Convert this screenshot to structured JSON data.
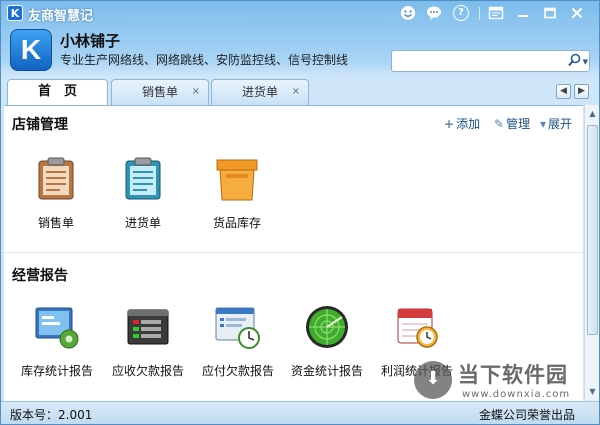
{
  "app": {
    "title": "友商智慧记",
    "icon_letter": "K"
  },
  "titlebar": {
    "icons": [
      "smiley-icon",
      "chat-icon",
      "help-icon",
      "skin-icon",
      "minimize-icon",
      "maximize-icon",
      "close-icon"
    ],
    "help_glyph": "?"
  },
  "header": {
    "shop_name": "小林铺子",
    "shop_desc": "专业生产网络线、网络跳线、安防监控线、信号控制线",
    "search": {
      "value": "",
      "placeholder": ""
    }
  },
  "tabs": [
    {
      "label": "首　页",
      "active": true,
      "closable": false
    },
    {
      "label": "销售单",
      "active": false,
      "closable": true
    },
    {
      "label": "进货单",
      "active": false,
      "closable": true
    }
  ],
  "close_glyph": "×",
  "store_section": {
    "title": "店铺管理",
    "actions": {
      "add": "添加",
      "manage": "管理",
      "expand": "展开"
    },
    "tiles": [
      {
        "label": "销售单",
        "icon": "clipboard-orange-icon"
      },
      {
        "label": "进货单",
        "icon": "clipboard-blue-icon"
      },
      {
        "label": "货品库存",
        "icon": "box-icon"
      }
    ]
  },
  "report_section": {
    "title": "经营报告",
    "tiles": [
      {
        "label": "库存统计报告",
        "icon": "monitor-gear-icon"
      },
      {
        "label": "应收欠款报告",
        "icon": "window-list-icon"
      },
      {
        "label": "应付欠款报告",
        "icon": "window-clock-icon"
      },
      {
        "label": "资金统计报告",
        "icon": "radar-icon"
      },
      {
        "label": "利润统计报告",
        "icon": "calendar-clock-icon"
      }
    ]
  },
  "statusbar": {
    "version": "版本号：2.001",
    "credit": "金蝶公司荣誉出品"
  },
  "watermark": {
    "text": "当下软件园",
    "url": "www.downxia.com"
  }
}
